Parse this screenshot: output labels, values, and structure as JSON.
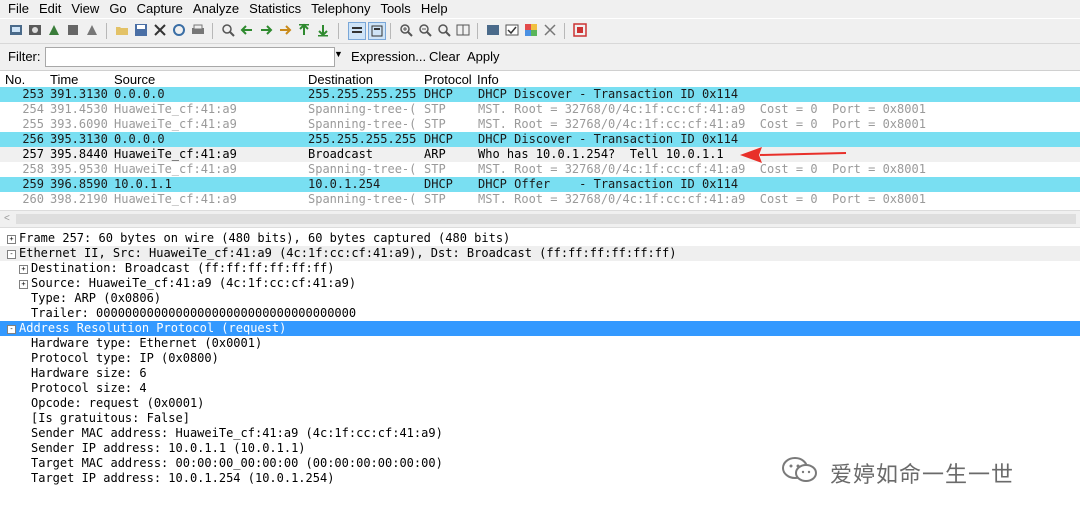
{
  "menu": [
    "File",
    "Edit",
    "View",
    "Go",
    "Capture",
    "Analyze",
    "Statistics",
    "Telephony",
    "Tools",
    "Help"
  ],
  "filter": {
    "label": "Filter:",
    "value": "",
    "expression_label": "Expression...",
    "clear_label": "Clear",
    "apply_label": "Apply"
  },
  "columns": [
    "No.",
    "Time",
    "Source",
    "Destination",
    "Protocol",
    "Info"
  ],
  "packets": [
    {
      "no": "253",
      "time": "391.3130",
      "src": "0.0.0.0",
      "dst": "255.255.255.255",
      "proto": "DHCP",
      "info": "DHCP Discover - Transaction ID 0x114",
      "style": "cyan"
    },
    {
      "no": "254",
      "time": "391.4530",
      "src": "HuaweiTe_cf:41:a9",
      "dst": "Spanning-tree-(",
      "proto": "STP",
      "info": "MST. Root = 32768/0/4c:1f:cc:cf:41:a9  Cost = 0  Port = 0x8001",
      "style": "grey"
    },
    {
      "no": "255",
      "time": "393.6090",
      "src": "HuaweiTe_cf:41:a9",
      "dst": "Spanning-tree-(",
      "proto": "STP",
      "info": "MST. Root = 32768/0/4c:1f:cc:cf:41:a9  Cost = 0  Port = 0x8001",
      "style": "grey"
    },
    {
      "no": "256",
      "time": "395.3130",
      "src": "0.0.0.0",
      "dst": "255.255.255.255",
      "proto": "DHCP",
      "info": "DHCP Discover - Transaction ID 0x114",
      "style": "cyan"
    },
    {
      "no": "257",
      "time": "395.8440",
      "src": "HuaweiTe_cf:41:a9",
      "dst": "Broadcast",
      "proto": "ARP",
      "info": "Who has 10.0.1.254?  Tell 10.0.1.1",
      "style": "sel"
    },
    {
      "no": "258",
      "time": "395.9530",
      "src": "HuaweiTe_cf:41:a9",
      "dst": "Spanning-tree-(",
      "proto": "STP",
      "info": "MST. Root = 32768/0/4c:1f:cc:cf:41:a9  Cost = 0  Port = 0x8001",
      "style": "grey"
    },
    {
      "no": "259",
      "time": "396.8590",
      "src": "10.0.1.1",
      "dst": "10.0.1.254",
      "proto": "DHCP",
      "info": "DHCP Offer    - Transaction ID 0x114",
      "style": "cyan"
    },
    {
      "no": "260",
      "time": "398.2190",
      "src": "HuaweiTe_cf:41:a9",
      "dst": "Spanning-tree-(",
      "proto": "STP",
      "info": "MST. Root = 32768/0/4c:1f:cc:cf:41:a9  Cost = 0  Port = 0x8001",
      "style": "grey"
    }
  ],
  "details": [
    {
      "text": "Frame 257: 60 bytes on wire (480 bits), 60 bytes captured (480 bits)",
      "indent": 0,
      "toggle": "+",
      "style": "plain"
    },
    {
      "text": "Ethernet II, Src: HuaweiTe_cf:41:a9 (4c:1f:cc:cf:41:a9), Dst: Broadcast (ff:ff:ff:ff:ff:ff)",
      "indent": 0,
      "toggle": "-",
      "style": "hdr"
    },
    {
      "text": "Destination: Broadcast (ff:ff:ff:ff:ff:ff)",
      "indent": 1,
      "toggle": "+",
      "style": "plain"
    },
    {
      "text": "Source: HuaweiTe_cf:41:a9 (4c:1f:cc:cf:41:a9)",
      "indent": 1,
      "toggle": "+",
      "style": "plain"
    },
    {
      "text": "Type: ARP (0x0806)",
      "indent": 1,
      "toggle": "",
      "style": "plain"
    },
    {
      "text": "Trailer: 000000000000000000000000000000000000",
      "indent": 1,
      "toggle": "",
      "style": "plain"
    },
    {
      "text": "Address Resolution Protocol (request)",
      "indent": 0,
      "toggle": "-",
      "style": "hl"
    },
    {
      "text": "Hardware type: Ethernet (0x0001)",
      "indent": 1,
      "toggle": "",
      "style": "plain"
    },
    {
      "text": "Protocol type: IP (0x0800)",
      "indent": 1,
      "toggle": "",
      "style": "plain"
    },
    {
      "text": "Hardware size: 6",
      "indent": 1,
      "toggle": "",
      "style": "plain"
    },
    {
      "text": "Protocol size: 4",
      "indent": 1,
      "toggle": "",
      "style": "plain"
    },
    {
      "text": "Opcode: request (0x0001)",
      "indent": 1,
      "toggle": "",
      "style": "plain"
    },
    {
      "text": "[Is gratuitous: False]",
      "indent": 1,
      "toggle": "",
      "style": "plain"
    },
    {
      "text": "Sender MAC address: HuaweiTe_cf:41:a9 (4c:1f:cc:cf:41:a9)",
      "indent": 1,
      "toggle": "",
      "style": "plain"
    },
    {
      "text": "Sender IP address: 10.0.1.1 (10.0.1.1)",
      "indent": 1,
      "toggle": "",
      "style": "plain"
    },
    {
      "text": "Target MAC address: 00:00:00_00:00:00 (00:00:00:00:00:00)",
      "indent": 1,
      "toggle": "",
      "style": "plain"
    },
    {
      "text": "Target IP address: 10.0.1.254 (10.0.1.254)",
      "indent": 1,
      "toggle": "",
      "style": "plain"
    }
  ],
  "watermark": "爱婷如命一生一世",
  "colors": {
    "dhcp_row": "#79dff2",
    "selected_tree": "#3399ff",
    "annotation_arrow": "#e8302a"
  }
}
